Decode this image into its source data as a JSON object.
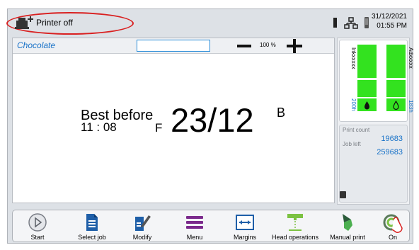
{
  "header": {
    "status_text": "Printer off",
    "date": "31/12/2021",
    "time": "01:55 PM",
    "icons": [
      "printer-add-icon",
      "ink-level-icon",
      "network-icon",
      "cartridge-icon"
    ]
  },
  "editor": {
    "job_name": "Chocolate",
    "field_value": "",
    "zoom_label": "100 %",
    "message": {
      "best_before": "Best before",
      "time": "11 : 08",
      "letter_f": "F",
      "date": "23/12",
      "letter_b": "B"
    }
  },
  "consumables": {
    "ink_label": "Inkxxxxx",
    "additive_label": "Adxxxxx",
    "ink_hours": "200h",
    "additive_hours": "183h",
    "color": "#33e21f"
  },
  "counters": {
    "print_count_label": "Print count",
    "print_count_value": "19683",
    "job_left_label": "Job left",
    "job_left_value": "259683"
  },
  "toolbar": {
    "buttons": [
      {
        "label": "Start",
        "icon": "play-icon"
      },
      {
        "label": "Select job",
        "icon": "document-icon"
      },
      {
        "label": "Modify",
        "icon": "edit-icon"
      },
      {
        "label": "Menu",
        "icon": "menu-icon"
      },
      {
        "label": "Margins",
        "icon": "margins-icon"
      },
      {
        "label": "Head operations",
        "icon": "head-icon"
      },
      {
        "label": "Manual print",
        "icon": "manual-print-icon"
      },
      {
        "label": "On",
        "icon": "power-icon"
      }
    ]
  },
  "colors": {
    "accent_blue": "#1a73c8",
    "status_outline": "#d92020",
    "gauge_green": "#33e21f",
    "menu_purple": "#7b2a8c"
  }
}
